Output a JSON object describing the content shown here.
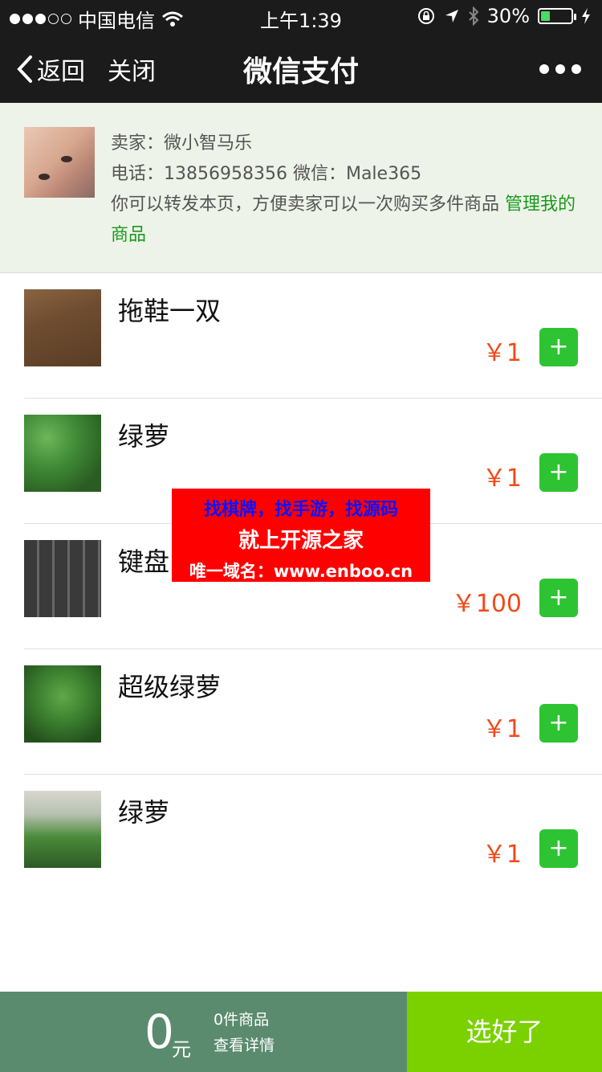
{
  "status_bar": {
    "carrier": "中国电信",
    "time": "上午1:39",
    "battery": "30%",
    "battery_level": 0.3,
    "icons": [
      "signal-dots",
      "wifi-icon",
      "lock-rotation-icon",
      "location-arrow-icon",
      "bluetooth-icon",
      "battery-icon",
      "charging-bolt-icon"
    ]
  },
  "nav": {
    "back_label": "返回",
    "close_label": "关闭",
    "title": "微信支付",
    "more_icon": "more-dots-icon"
  },
  "seller": {
    "seller_line": "卖家：微小智马乐",
    "contact_line": "电话：13856958356 微信：Male365",
    "hint_text": "你可以转发本页，方便卖家可以一次购买多件商品 ",
    "manage_link": "管理我的商品"
  },
  "products": [
    {
      "name": "拖鞋一双",
      "price": "￥1",
      "add_label": "+"
    },
    {
      "name": "绿萝",
      "price": "￥1",
      "add_label": "+"
    },
    {
      "name": "键盘",
      "price": "￥100",
      "add_label": "+"
    },
    {
      "name": "超级绿萝",
      "price": "￥1",
      "add_label": "+"
    },
    {
      "name": "绿萝",
      "price": "￥1",
      "add_label": "+"
    }
  ],
  "ad_banner": {
    "line1": "找棋牌，找手游，找源码",
    "line2": "就上开源之家",
    "line3": "唯一域名：www.enboo.cn"
  },
  "bottom_bar": {
    "total": "0",
    "unit": "元",
    "count": "0件商品",
    "details": "查看详情",
    "confirm": "选好了"
  },
  "colors": {
    "nav_bg": "#1b1b1b",
    "seller_bg": "#eef3ea",
    "price": "#f04a1b",
    "add_button": "#2ec332",
    "summary_bg": "#5b8b6e",
    "confirm_bg": "#7bd100",
    "link": "#1a9a1a"
  }
}
